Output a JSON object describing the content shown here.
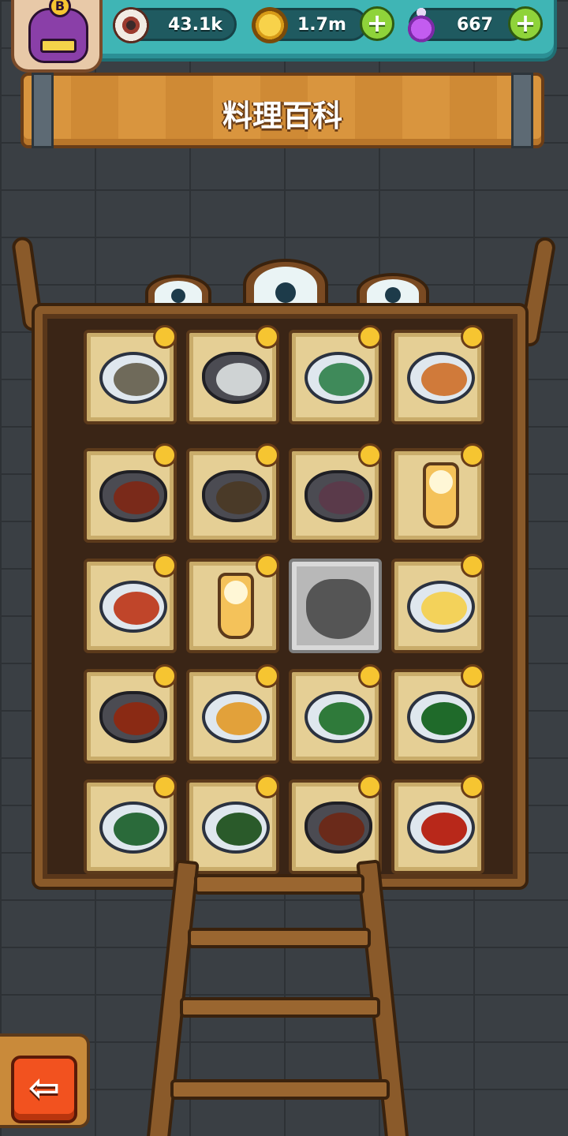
{
  "header": {
    "avatar_badge": "B",
    "eyeballs": "43.1k",
    "coins": "1.7m",
    "potions": "667",
    "plus_label": "+"
  },
  "page_title": "料理百科",
  "grid": {
    "slots": [
      {
        "row": 1,
        "col": 1,
        "kind": "plate",
        "food": "#6f6a5a",
        "locked": false
      },
      {
        "row": 1,
        "col": 2,
        "kind": "bowl",
        "food": "#cfd3d4",
        "locked": false
      },
      {
        "row": 1,
        "col": 3,
        "kind": "plate",
        "food": "#3f8a5a",
        "locked": false
      },
      {
        "row": 1,
        "col": 4,
        "kind": "plate",
        "food": "#d07a3a",
        "locked": false
      },
      {
        "row": 2,
        "col": 1,
        "kind": "bowl",
        "food": "#7a2a1a",
        "locked": false
      },
      {
        "row": 2,
        "col": 2,
        "kind": "bowl",
        "food": "#4a3a28",
        "locked": false
      },
      {
        "row": 2,
        "col": 3,
        "kind": "bowl",
        "food": "#5a3a4a",
        "locked": false
      },
      {
        "row": 2,
        "col": 4,
        "kind": "glass",
        "food": "#f7e7b0",
        "locked": false
      },
      {
        "row": 3,
        "col": 1,
        "kind": "plate",
        "food": "#c0452a",
        "locked": false
      },
      {
        "row": 3,
        "col": 2,
        "kind": "glass",
        "food": "#f4b13a",
        "locked": false
      },
      {
        "row": 3,
        "col": 3,
        "kind": "silhouette",
        "food": "#555555",
        "locked": true
      },
      {
        "row": 3,
        "col": 4,
        "kind": "plate",
        "food": "#f3d25a",
        "locked": false
      },
      {
        "row": 4,
        "col": 1,
        "kind": "bowl",
        "food": "#8a2a14",
        "locked": false
      },
      {
        "row": 4,
        "col": 2,
        "kind": "plate",
        "food": "#e2a13a",
        "locked": false
      },
      {
        "row": 4,
        "col": 3,
        "kind": "plate",
        "food": "#2f7a3a",
        "locked": false
      },
      {
        "row": 4,
        "col": 4,
        "kind": "plate",
        "food": "#1f6a2a",
        "locked": false
      },
      {
        "row": 5,
        "col": 1,
        "kind": "plate",
        "food": "#2a6a3a",
        "locked": false
      },
      {
        "row": 5,
        "col": 2,
        "kind": "plate",
        "food": "#2a5a2a",
        "locked": false
      },
      {
        "row": 5,
        "col": 3,
        "kind": "bowl",
        "food": "#6a2a1a",
        "locked": false
      },
      {
        "row": 5,
        "col": 4,
        "kind": "plate",
        "food": "#b8281a",
        "locked": false
      }
    ]
  },
  "back_button": {
    "icon": "arrow-left-icon",
    "glyph": "⇦"
  },
  "colors": {
    "topbar": "#3fb5b5",
    "plank": "#d9953e",
    "frame": "#8a5a2a",
    "back_button": "#f2521f"
  }
}
